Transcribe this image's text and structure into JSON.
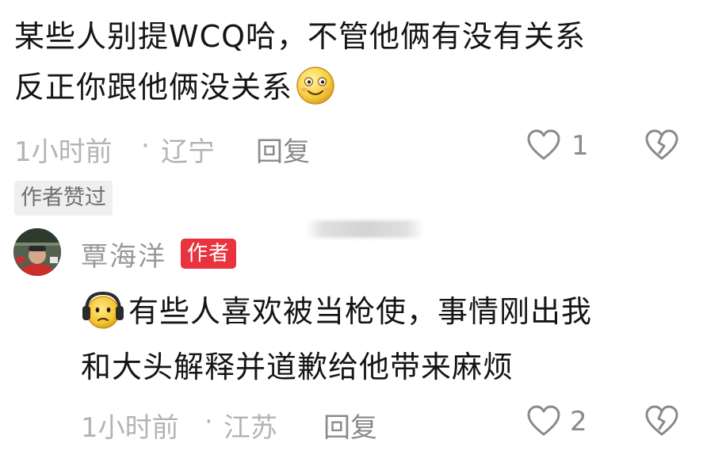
{
  "comments": [
    {
      "text_lines": [
        "某些人别提WCQ哈，不管他俩有没有关系",
        "反正你跟他俩没关系"
      ],
      "inline_emoji": "smiling-face-emoji",
      "time": "1小时前",
      "separator": "·",
      "location": "辽宁",
      "reply_label": "回复",
      "like_count": "1",
      "author_liked_label": "作者赞过"
    },
    {
      "username": "覃海洋",
      "author_badge": "作者",
      "inline_emoji": "headphone-face-emoji",
      "text_lines": [
        "有些人喜欢被当枪使，事情刚出我",
        "和大头解释并道歉给他带来麻烦"
      ],
      "time": "1小时前",
      "separator": "·",
      "location": "江苏",
      "reply_label": "回复",
      "like_count": "2"
    }
  ],
  "icons": {
    "like": "heart-outline-icon",
    "dislike": "broken-heart-icon"
  },
  "colors": {
    "author_badge_bg": "#e9343f",
    "meta_text": "#b4b4b4",
    "username": "#999999"
  }
}
